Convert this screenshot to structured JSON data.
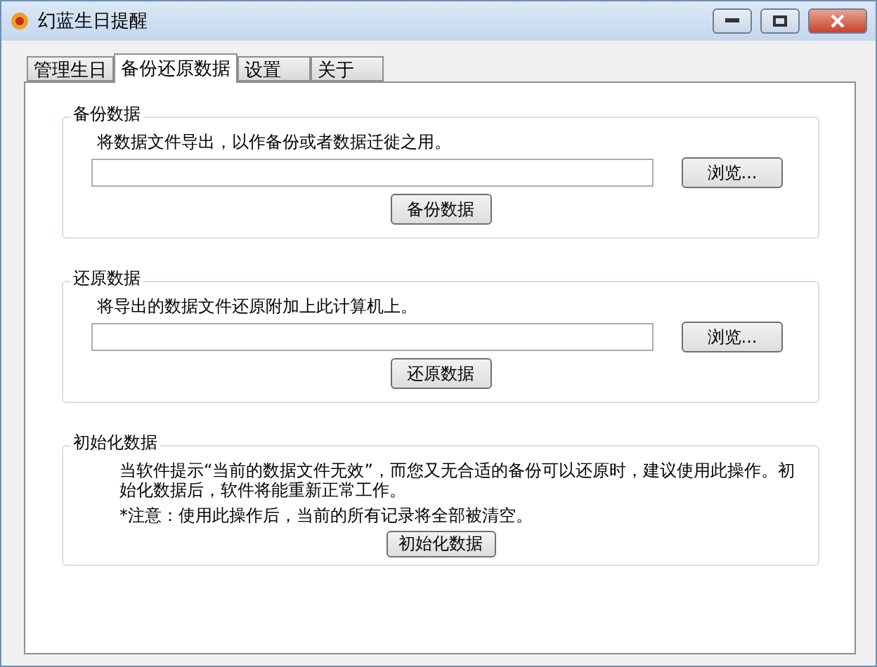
{
  "window": {
    "title": "幻蓝生日提醒"
  },
  "tabs": [
    {
      "label": "管理生日",
      "selected": false
    },
    {
      "label": "备份还原数据",
      "selected": true
    },
    {
      "label": "设置",
      "selected": false
    },
    {
      "label": "关于",
      "selected": false
    }
  ],
  "sections": [
    {
      "kind": "file",
      "title": "备份数据",
      "description": "将数据文件导出，以作备份或者数据迁徙之用。",
      "browse_button": "浏览...",
      "action_button": "备份数据"
    },
    {
      "kind": "file",
      "title": "还原数据",
      "description": "将导出的数据文件还原附加上此计算机上。",
      "browse_button": "浏览...",
      "action_button": "还原数据"
    },
    {
      "kind": "notice",
      "title": "初始化数据",
      "description": "当软件提示“当前的数据文件无效”，而您又无合适的备份可以还原时，建议使用此操作。初始化数据后，软件将能重新正常工作。",
      "warning": "*注意：使用此操作后，当前的所有记录将全部被清空。",
      "action_button": "初始化数据"
    }
  ]
}
